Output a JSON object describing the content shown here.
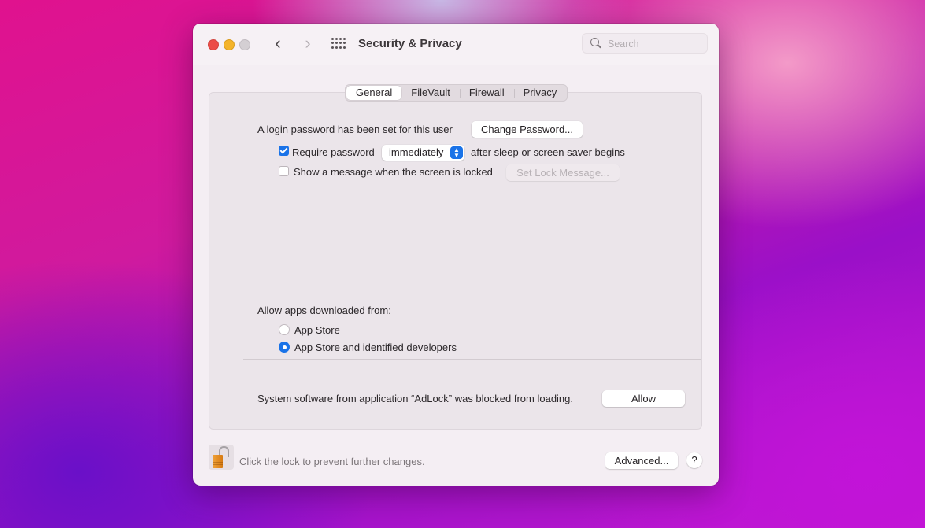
{
  "window": {
    "title": "Security & Privacy",
    "search_placeholder": "Search",
    "back_glyph": "‹",
    "forward_glyph": "›"
  },
  "tabs": [
    {
      "label": "General",
      "active": true
    },
    {
      "label": "FileVault",
      "active": false
    },
    {
      "label": "Firewall",
      "active": false
    },
    {
      "label": "Privacy",
      "active": false
    }
  ],
  "general": {
    "login_password_text": "A login password has been set for this user",
    "change_password_button": "Change Password...",
    "require_password": {
      "checked": true,
      "label": "Require password",
      "select_value": "immediately",
      "suffix": "after sleep or screen saver begins"
    },
    "show_message": {
      "checked": false,
      "label": "Show a message when the screen is locked",
      "button": "Set Lock Message...",
      "button_enabled": false
    },
    "allow_apps": {
      "heading": "Allow apps downloaded from:",
      "options": [
        {
          "label": "App Store",
          "selected": false
        },
        {
          "label": "App Store and identified developers",
          "selected": true
        }
      ]
    },
    "blocked_software": {
      "text": "System software from application “AdLock” was blocked from loading.",
      "button": "Allow"
    }
  },
  "footer": {
    "lock_text": "Click the lock to prevent further changes.",
    "lock_state": "unlocked",
    "advanced_button": "Advanced...",
    "help_button": "?"
  },
  "colors": {
    "accent": "#1a73e8",
    "close": "#ec4c47",
    "minimize": "#f4b42a",
    "zoom_disabled": "#d4cfd3"
  }
}
